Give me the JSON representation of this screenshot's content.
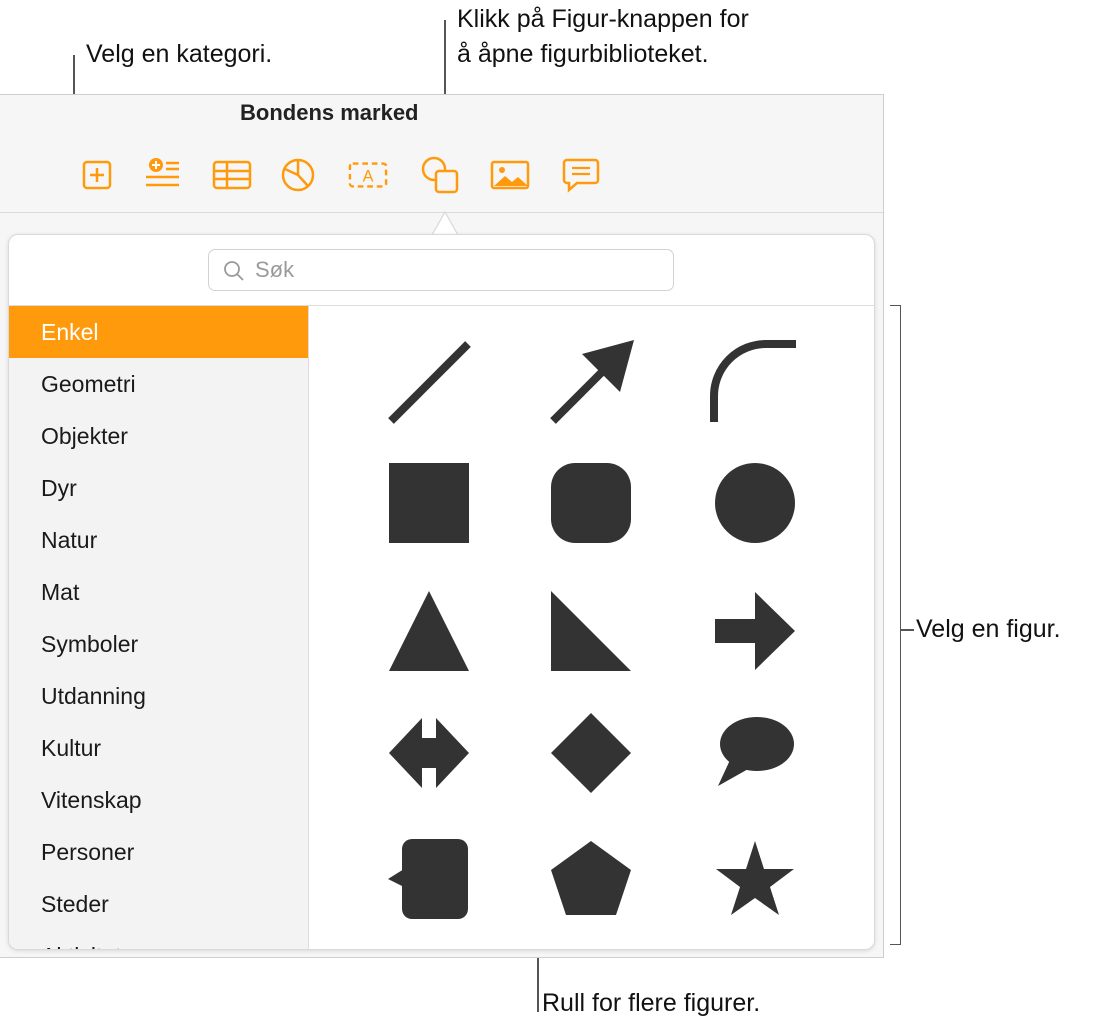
{
  "callouts": {
    "category": "Velg en kategori.",
    "shape_button_line1": "Klikk på Figur-knappen for",
    "shape_button_line2": "å åpne figurbiblioteket.",
    "choose_shape": "Velg en figur.",
    "scroll": "Rull for flere figurer."
  },
  "window": {
    "title": "Bondens marked",
    "toolbar_icons": [
      "add-page-icon",
      "insert-text-list-icon",
      "table-icon",
      "chart-icon",
      "text-box-icon",
      "shape-icon",
      "media-icon",
      "comment-icon"
    ],
    "accent_color": "#ff9a0d"
  },
  "library": {
    "search_placeholder": "Søk",
    "categories": [
      "Enkel",
      "Geometri",
      "Objekter",
      "Dyr",
      "Natur",
      "Mat",
      "Symboler",
      "Utdanning",
      "Kultur",
      "Vitenskap",
      "Personer",
      "Steder",
      "Aktiviteter"
    ],
    "selected_category": "Enkel",
    "shapes": [
      "line",
      "arrow-line",
      "curve",
      "square",
      "rounded-square",
      "circle",
      "triangle",
      "right-triangle",
      "arrow",
      "double-arrow",
      "diamond",
      "speech-bubble",
      "callout-square",
      "pentagon",
      "star"
    ],
    "shape_color": "#333333"
  }
}
